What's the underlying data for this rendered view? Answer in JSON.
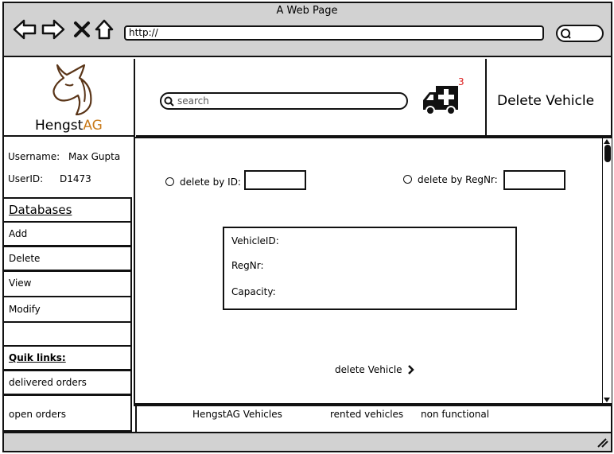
{
  "browser": {
    "title": "A Web Page",
    "url": "http://"
  },
  "header": {
    "brand_prefix": "Hengst",
    "brand_suffix": "AG",
    "search_placeholder": "search",
    "notification_count": "3",
    "page_title": "Delete Vehicle"
  },
  "user": {
    "username_label": "Username:",
    "username": "Max Gupta",
    "userid_label": "UserID:",
    "userid": "D1473"
  },
  "sidebar": {
    "databases_title": "Databases",
    "items": [
      "Add",
      "Delete",
      "View",
      "Modify"
    ],
    "quicklinks_title": "Quik links:",
    "quicklinks": [
      "delivered orders",
      "open orders"
    ]
  },
  "form": {
    "option_id": "delete by ID:",
    "option_regnr": "delete by RegNr:",
    "info_fields": [
      "VehicleID:",
      "RegNr:",
      "Capacity:"
    ],
    "submit_label": "delete Vehicle"
  },
  "footer_links": [
    "HengstAG Vehicles",
    "rented vehicles",
    "non functional"
  ]
}
